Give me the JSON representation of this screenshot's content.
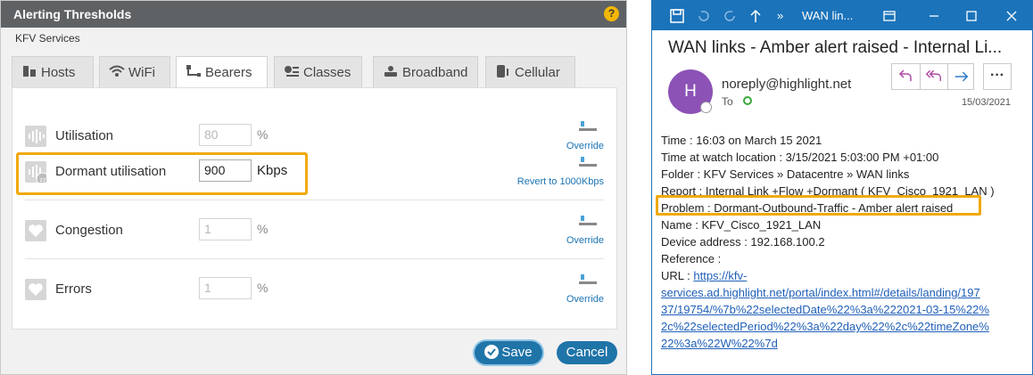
{
  "dialog": {
    "title": "Alerting Thresholds",
    "help_icon": "question-icon",
    "help_glyph": "?",
    "subtitle": "KFV Services",
    "tabs": [
      {
        "label": "Hosts",
        "icon": "hosts-icon",
        "active": false
      },
      {
        "label": "WiFi",
        "icon": "wifi-icon",
        "active": false
      },
      {
        "label": "Bearers",
        "icon": "bearers-icon",
        "active": true
      },
      {
        "label": "Classes",
        "icon": "classes-icon",
        "active": false
      },
      {
        "label": "Broadband",
        "icon": "broadband-icon",
        "active": false
      },
      {
        "label": "Cellular",
        "icon": "cellular-icon",
        "active": false
      }
    ],
    "rows": [
      {
        "label": "Utilisation",
        "value": "80",
        "unit": "%",
        "link": "Override",
        "icon": "utilisation-icon"
      },
      {
        "label": "Dormant utilisation",
        "value": "900",
        "unit": "Kbps",
        "link": "Revert to 1000Kbps",
        "icon": "dormant-utilisation-icon"
      },
      {
        "label": "Congestion",
        "value": "1",
        "unit": "%",
        "link": "Override",
        "icon": "congestion-heart-icon"
      },
      {
        "label": "Errors",
        "value": "1",
        "unit": "%",
        "link": "Override",
        "icon": "errors-heart-icon"
      }
    ],
    "buttons": {
      "save": "Save",
      "cancel": "Cancel"
    },
    "colors": {
      "titlebar": "#5f6265",
      "button": "#1f74a8",
      "highlight": "#f0a90a",
      "link": "#1b73b3"
    }
  },
  "email": {
    "toolbar": {
      "window_title": "WAN lin...",
      "more_glyph": "»",
      "icons": [
        "save-icon",
        "undo-icon",
        "redo-icon",
        "up-arrow-icon",
        "more-icon",
        "popout-icon",
        "minimize-icon",
        "maximize-icon",
        "close-icon"
      ]
    },
    "subject": "WAN links - Amber alert raised - Internal Li...",
    "avatar_letter": "H",
    "sender": "noreply@highlight.net",
    "to_label": "To",
    "date": "15/03/2021",
    "actions": {
      "reply": "reply-icon",
      "reply_all": "reply-all-icon",
      "forward": "forward-icon",
      "more_glyph": "···"
    },
    "body_lines": [
      "Time : 16:03 on March 15 2021",
      "Time at watch location : 3/15/2021 5:03:00 PM +01:00",
      "Folder : KFV Services » Datacentre » WAN links",
      "Report : Internal Link +Flow +Dormant ( KFV_Cisco_1921_LAN )",
      "Problem : Dormant-Outbound-Traffic - Amber alert raised",
      "Name : KFV_Cisco_1921_LAN",
      "Device address : 192.168.100.2",
      "Reference :"
    ],
    "url_label": "URL : ",
    "url_lines": [
      "https://kfv-",
      "services.ad.highlight.net/portal/index.html#/details/landing/197",
      "37/19754/%7b%22selectedDate%22%3a%222021-03-15%22%",
      "2c%22selectedPeriod%22%3a%22day%22%2c%22timeZone%",
      "22%3a%22W%22%7d"
    ],
    "colors": {
      "titlebar": "#1b73ba",
      "avatar": "#8c52b6",
      "link": "#1f5fb8"
    }
  }
}
